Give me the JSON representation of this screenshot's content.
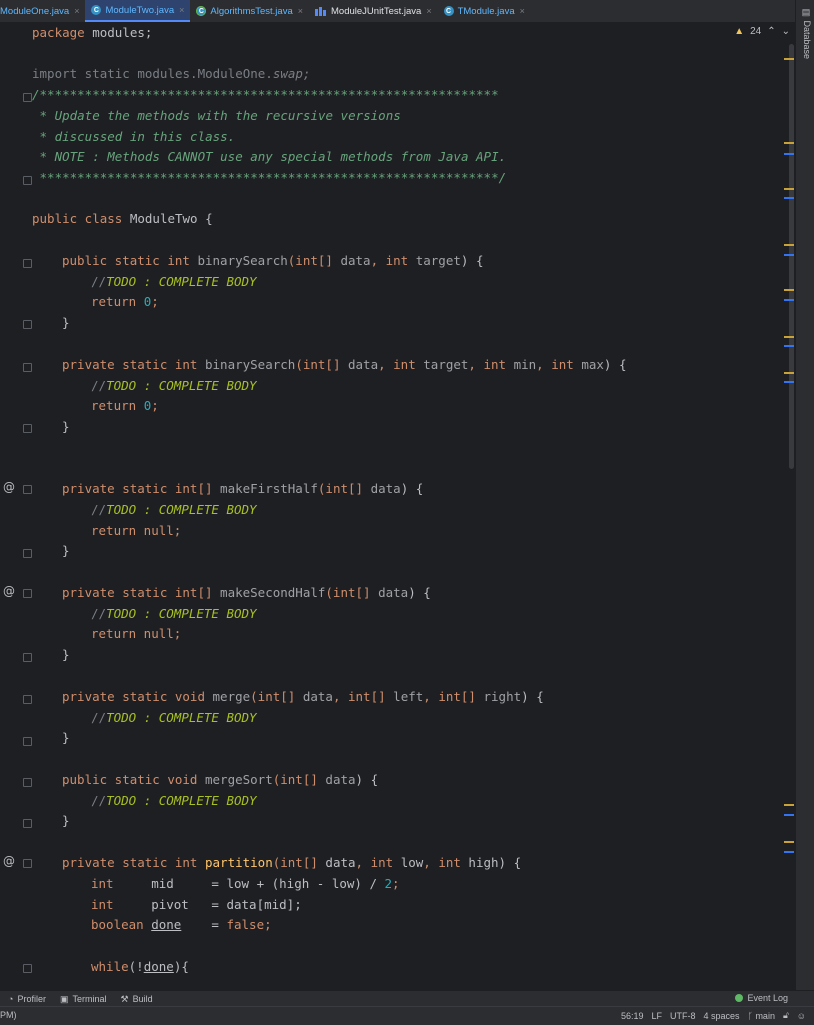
{
  "tabs": [
    {
      "label": "ModuleOne.java",
      "icon": "none",
      "active": false
    },
    {
      "label": "ModuleTwo.java",
      "icon": "class-icon",
      "active": true
    },
    {
      "label": "AlgorithmsTest.java",
      "icon": "class-icon",
      "active": false
    },
    {
      "label": "ModuleJUnitTest.java",
      "icon": "junit-icon",
      "active": false
    },
    {
      "label": "TModule.java",
      "icon": "class-icon",
      "active": false
    }
  ],
  "right_panel": {
    "database_label": "Database"
  },
  "inspections": {
    "warning_count": "24"
  },
  "code": {
    "l1_pkg": "package",
    "l1_name": " modules;",
    "l3": "import static modules.ModuleOne.",
    "l3_swap": "swap;",
    "l4": "/*************************************************************",
    "l5": " * Update the methods with the recursive versions",
    "l6": " * discussed in this class.",
    "l7": " * NOTE : Methods CANNOT use any special methods from Java API.",
    "l8": " *************************************************************/",
    "l10_a": "public class ",
    "l10_b": "ModuleTwo {",
    "todo_prefix": "//",
    "todo_text": "TODO : COMPLETE BODY",
    "return_zero": "return ",
    "zero": "0",
    "return_null": "return null;",
    "close_brace": "}",
    "m1_sig_a": "public static int ",
    "m1_name": "binarySearch",
    "m1_p1": "(int[] ",
    "m1_p2": "data",
    "m1_p3": ", int ",
    "m1_p4": "target",
    "m1_p5": ") {",
    "m2_sig_a": "private static int ",
    "m2_name": "binarySearch",
    "m2_rest_a": "(int[] ",
    "m2_data": "data",
    "m2_int1": ", int ",
    "m2_target": "target",
    "m2_int2": ", int ",
    "m2_min": "min",
    "m2_int3": ", int ",
    "m2_max": "max",
    "m2_end": ") {",
    "m3_a": "private static int[] ",
    "m3_name": "makeFirstHalf",
    "m3_b": "(int[] ",
    "m3_data": "data",
    "m3_end": ") {",
    "m4_a": "private static int[] ",
    "m4_name": "makeSecondHalf",
    "m4_b": "(int[] ",
    "m4_data": "data",
    "m4_end": ") {",
    "m5_a": "private static void ",
    "m5_name": "merge",
    "m5_b": "(int[] ",
    "m5_data": "data",
    "m5_c": ", int[] ",
    "m5_left": "left",
    "m5_d": ", int[] ",
    "m5_right": "right",
    "m5_end": ") {",
    "m6_a": "public static void ",
    "m6_name": "mergeSort",
    "m6_b": "(int[] ",
    "m6_data": "data",
    "m6_end": ") {",
    "m7_a": "private static int ",
    "m7_name": "partition",
    "m7_b": "(int[] ",
    "m7_data": "data",
    "m7_c": ", int ",
    "m7_low": "low",
    "m7_d": ", int ",
    "m7_high": "high",
    "m7_end": ") {",
    "v1_type": "int",
    "v1_name": "     mid",
    "v1_rest_a": "     = low + (high - low) / ",
    "v1_two": "2",
    "v1_semi": ";",
    "v2_type": "int",
    "v2_name": "     pivot",
    "v2_rest": "   = data[mid];",
    "v3_type": "boolean ",
    "v3_name": "done",
    "v3_rest_a": "    = ",
    "v3_false": "false",
    "v3_semi": ";",
    "w_kw": "while",
    "w_a": "(!",
    "w_done": "done",
    "w_b": "){"
  },
  "tool_windows": {
    "profiler": "Profiler",
    "terminal": "Terminal",
    "build": "Build",
    "event_log": "Event Log"
  },
  "status": {
    "left": "PM)",
    "position": "56:19",
    "line_sep": "LF",
    "encoding": "UTF-8",
    "indent": "4 spaces",
    "branch": "main"
  }
}
